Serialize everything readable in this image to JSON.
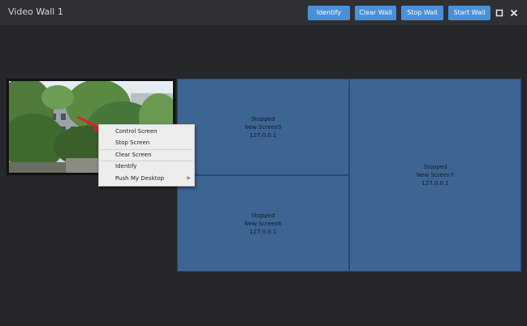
{
  "window": {
    "title": "Video Wall 1"
  },
  "toolbar": {
    "identify": "Identify",
    "clear_wall": "Clear Wall",
    "stop_wall": "Stop Wall",
    "start_wall": "Start Wall"
  },
  "window_controls": {
    "maximize_icon": "square-icon",
    "close_icon": "close-icon"
  },
  "screens": [
    {
      "status": "Stopped",
      "name": "New Screen5",
      "ip": "127.0.0.1"
    },
    {
      "status": "Stopped",
      "name": "New Screen6",
      "ip": "127.0.0.1"
    },
    {
      "status": "Stopped",
      "name": "New Screen7",
      "ip": "127.0.0.1"
    }
  ],
  "context_menu": {
    "items": [
      "Control Screen",
      "Stop Screen",
      "Clear Screen",
      "Identify",
      "Push My Desktop"
    ]
  },
  "colors": {
    "accent": "#4a90d9",
    "screen": "#3d6594",
    "background": "#25272b",
    "arrow": "#e0202a"
  }
}
